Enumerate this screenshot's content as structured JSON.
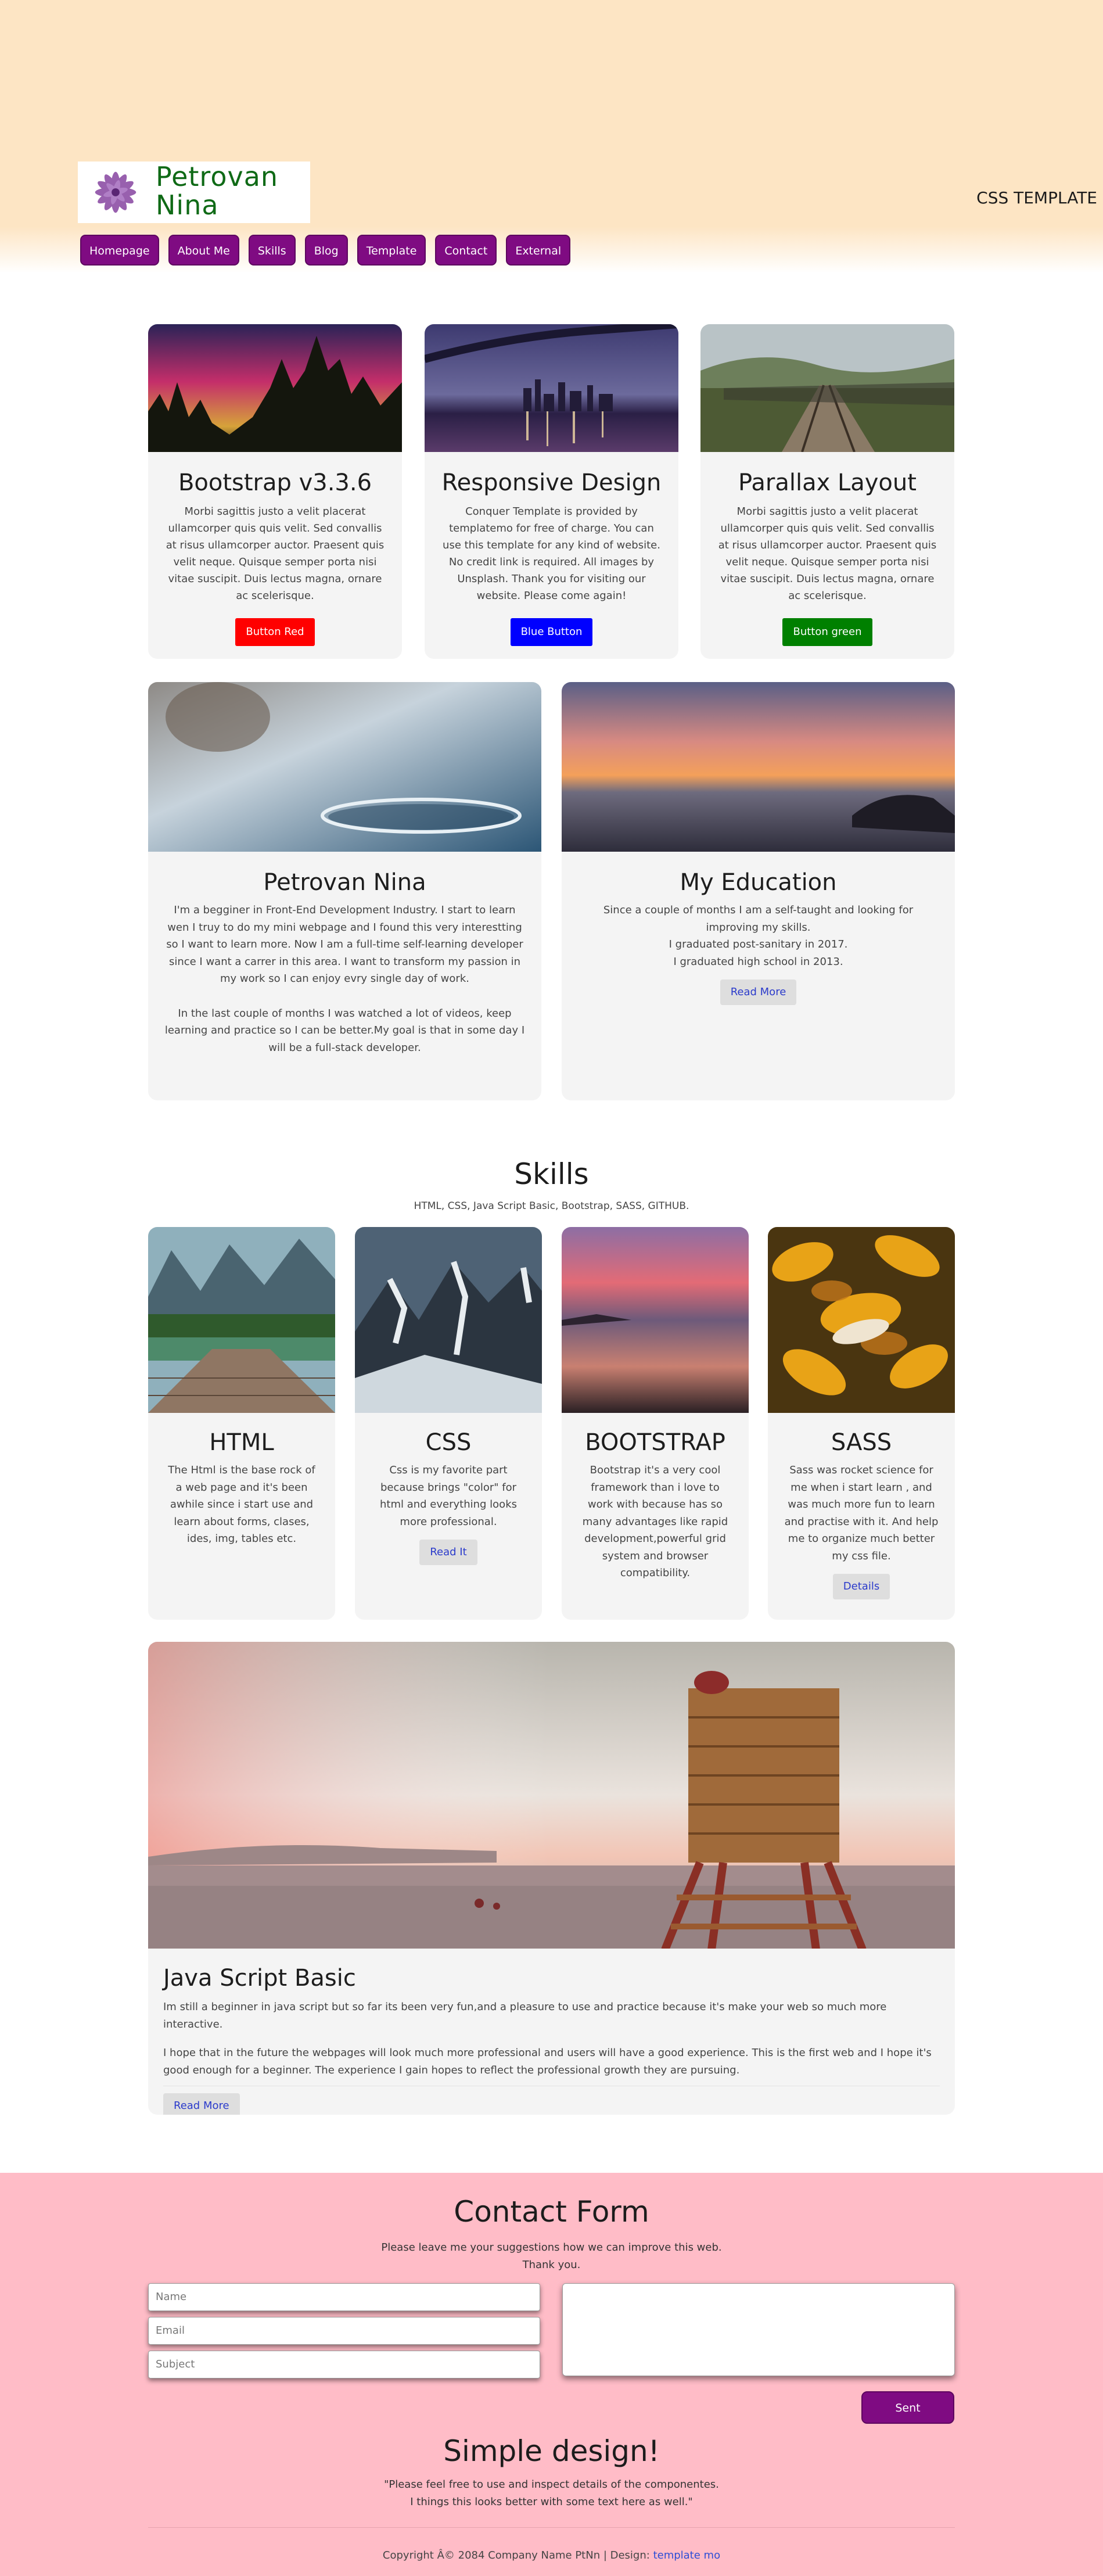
{
  "header": {
    "logo_line1": "Petrovan",
    "logo_line2": "Nina",
    "brand_right": "CSS TEMPLATE",
    "nav": [
      "Homepage",
      "About Me",
      "Skills",
      "Blog",
      "Template",
      "Contact",
      "External"
    ]
  },
  "row1": [
    {
      "title": "Bootstrap v3.3.6",
      "text": "Morbi sagittis justo a velit placerat ullamcorper quis quis velit. Sed convallis at risus ullamcorper auctor. Praesent quis velit neque. Quisque semper porta nisi vitae suscipit. Duis lectus magna, ornare ac scelerisque.",
      "button": "Button Red",
      "button_color": "#ff0000",
      "image": "aurora-forest"
    },
    {
      "title": "Responsive Design",
      "text": "Conquer Template is provided by templatemo for free of charge. You can use this template for any kind of website. No credit link is required. All images by Unsplash. Thank you for visiting our website. Please come again!",
      "button": "Blue Button",
      "button_color": "#0000ff",
      "image": "city-bridge-night"
    },
    {
      "title": "Parallax Layout",
      "text": "Morbi sagittis justo a velit placerat ullamcorper quis quis velit. Sed convallis at risus ullamcorper auctor. Praesent quis velit neque. Quisque semper porta nisi vitae suscipit. Duis lectus magna, ornare ac scelerisque.",
      "button": "Button green",
      "button_color": "#008000",
      "image": "railway-bridge"
    }
  ],
  "about": {
    "title": "Petrovan Nina",
    "p1": "I'm a begginer in Front-End Development Industry. I start to learn wen I truy to do my mini webpage and I found this very interestting so I want to learn more. Now I am a full-time self-learning developer since I want a carrer in this area. I want to transform my passion in my work so I can enjoy evry single day of work.",
    "p2": "In the last couple of months I was watched a lot of videos, keep learning and practice so I can be better.My goal is that in some day I will be a full-stack developer."
  },
  "education": {
    "title": "My Education",
    "line1": "Since a couple of months I am a self-taught and looking for improving my skills.",
    "line2": "I graduated post-sanitary in 2017.",
    "line3": "I graduated high school in 2013.",
    "button": "Read More"
  },
  "skills": {
    "title": "Skills",
    "subtitle": "HTML, CSS, Java Script Basic, Bootstrap, SASS, GITHUB.",
    "items": [
      {
        "title": "HTML",
        "text": "The Html is the base rock of a web page and it's been awhile since i start use and learn about forms, clases, ides, img, tables etc.",
        "button": ""
      },
      {
        "title": "CSS",
        "text": "Css is my favorite part because brings \"color\" for html and everything looks more professional.",
        "button": "Read It"
      },
      {
        "title": "BOOTSTRAP",
        "text": "Bootstrap it's a very cool framework than i love to work with because has so many advantages like rapid development,powerful grid system and browser compatibility.",
        "button": ""
      },
      {
        "title": "SASS",
        "text": "Sass was rocket science for me when i start learn , and was much more fun to learn and practise with it. And help me to organize much better my css file.",
        "button": "Details"
      }
    ]
  },
  "jsbasic": {
    "title": "Java Script Basic",
    "p1": "Im still a beginner in java script but so far its been very fun,and a pleasure to use and practice because it's make your web so much more interactive.",
    "p2": "I hope that in the future the webpages will look much more professional and users will have a good experience. This is the first web and I hope it's good enough for a beginner. The experience I gain hopes to reflect the professional growth they are pursuing.",
    "button": "Read More"
  },
  "contact": {
    "title": "Contact Form",
    "sub1": "Please leave me your suggestions how we can improve this web.",
    "sub2": "Thank you.",
    "name_placeholder": "Name",
    "email_placeholder": "Email",
    "subject_placeholder": "Subject",
    "send": "Sent",
    "simple_title": "Simple design!",
    "simple_sub1": "\"Please feel free to use and inspect details of the componentes.",
    "simple_sub2": "I things this looks better with some text here as well.\"",
    "copyright": "Copyright Â© 2084 Company Name PtNn | Design: ",
    "design_link": "template mo"
  }
}
